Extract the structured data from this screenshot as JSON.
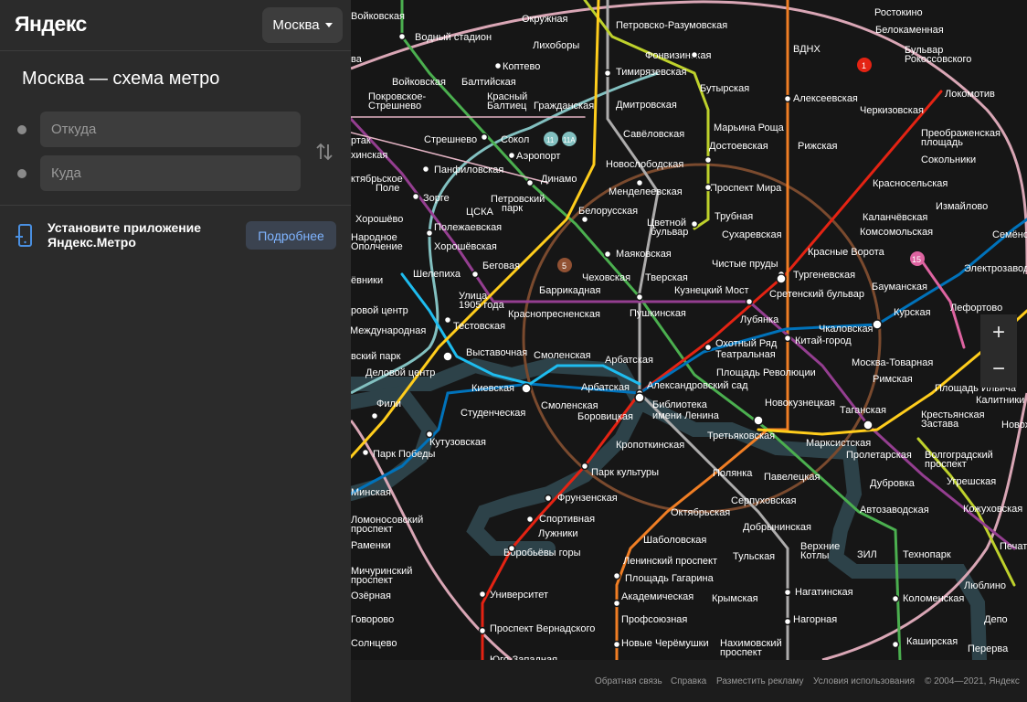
{
  "brand": "Яндекс",
  "city": "Москва",
  "page_title": "Москва — схема метро",
  "route": {
    "from_placeholder": "Откуда",
    "to_placeholder": "Куда"
  },
  "promo": {
    "text": "Установите приложение Яндекс.Метро",
    "button": "Подробнее"
  },
  "zoom": {
    "in": "+",
    "out": "−"
  },
  "footer": {
    "feedback": "Обратная связь",
    "help": "Справка",
    "ads": "Разместить рекламу",
    "terms": "Условия использования",
    "copyright": "© 2004—2021, Яндекс"
  },
  "colors": {
    "sokolnicheskaya": "#e42313",
    "zamoskvoretskaya": "#4baf4f",
    "arbatsko_pokrovskaya": "#0072ba",
    "filyovskaya": "#1ebcef",
    "koltsevaya": "#915133",
    "kaluzhsko_rizhskaya": "#f07e24",
    "tagansko_krasnopresnenskaya": "#943e90",
    "kalininskaya": "#ffcd1c",
    "serpukhovsko_timiryazevskaya": "#adacac",
    "lyublinskaya": "#bed12c",
    "bkl": "#82c0c0",
    "mck": "#f9bcd1",
    "river": "#2d4249"
  },
  "stations": [
    "Окружная",
    "Петровско-Разумовская",
    "Ростокино",
    "Белокаменная",
    "Бульвар Рокоссовского",
    "Водный стадион",
    "Лихоборы",
    "Фонвизинская",
    "ВДНХ",
    "Локомотив",
    "Коптево",
    "Тимирязевская",
    "Бутырская",
    "Войковская",
    "Балтийская",
    "Алексеевская",
    "Черкизовская",
    "Покровское-Стрешнево",
    "Красный Балтиец",
    "Гражданская",
    "Дмитровская",
    "Марьина Роща",
    "Преображенская площадь",
    "Стрешнево",
    "Сокол",
    "Савёловская",
    "Рижская",
    "Достоевская",
    "Сокольники",
    "Аэропорт",
    "Новослободская",
    "Панфиловская",
    "Динамо",
    "Менделеевская",
    "Проспект Мира",
    "Красносельская",
    "Зорге",
    "Петровский парк",
    "Измайлово",
    "ЦСКА",
    "Белорусская",
    "Цветной бульвар",
    "Трубная",
    "Хорошёво",
    "Полежаевская",
    "Каланчёвская",
    "Комсомольская",
    "Сухаревская",
    "Хорошёвская",
    "Беговая",
    "Маяковская",
    "Чистые пруды",
    "Красные Ворота",
    "Шелепиха",
    "Чеховская",
    "Тверская",
    "Тургеневская",
    "Бауманская",
    "Электрозаводская",
    "Улица 1905 года",
    "Баррикадная",
    "Кузнецкий Мост",
    "Сретенский бульвар",
    "Пушкинская",
    "Краснопресненская",
    "Лубянка",
    "Курская",
    "Лефортово",
    "Тестовская",
    "Чкаловская",
    "Выставочная",
    "Охотный Ряд",
    "Театральная",
    "Китай-город",
    "Деловой центр",
    "Смоленская",
    "Арбатская",
    "Площадь Революции",
    "Москва-Товарная",
    "Римская",
    "Киевская",
    "Александровский сад",
    "Площадь Ильича",
    "Фили",
    "Студенческая",
    "Смоленская",
    "Библиотека имени Ленина",
    "Новокузнецкая",
    "Таганская",
    "Калитники",
    "Кутузовская",
    "Боровицкая",
    "Третьяковская",
    "Крестьянская Застава",
    "Парк Победы",
    "Кропоткинская",
    "Марксистская",
    "Пролетарская",
    "Волгоградский проспект",
    "Парк культуры",
    "Полянка",
    "Павелецкая",
    "Дубровка",
    "Угрешская",
    "Минская",
    "Фрунзенская",
    "Серпуховская",
    "Автозаводская",
    "Кожуховская",
    "Спортивная",
    "Октябрьская",
    "Добрынинская",
    "Ломоносовский проспект",
    "Лужники",
    "Шаболовская",
    "Тульская",
    "Верхние Котлы",
    "ЗИЛ",
    "Технопарк",
    "Раменки",
    "Воробьёвы горы",
    "Ленинский проспект",
    "Мичуринский проспект",
    "Площадь Гагарина",
    "Крымская",
    "Нагатинская",
    "Коломенская",
    "Люблино",
    "Озёрная",
    "Университет",
    "Академическая",
    "Профсоюзная",
    "Нагорная",
    "Депо",
    "Говорово",
    "Проспект Вернадского",
    "Новые Черёмушки",
    "Нахимовский проспект",
    "Каширская",
    "Перерва",
    "Солнцево",
    "Юго-Западная",
    "Семёновская",
    "Стрешнево",
    "Народное Ополчение",
    "Октябрьское Поле",
    "Международная",
    "Новохохловская",
    "Печатники"
  ]
}
